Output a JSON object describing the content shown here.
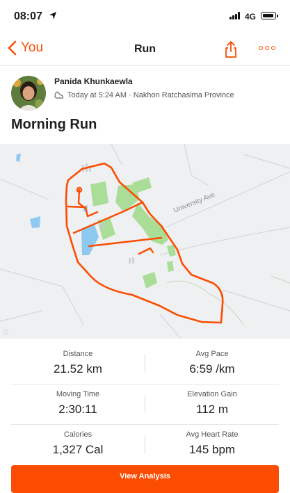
{
  "status_bar": {
    "time": "08:07",
    "network": "4G"
  },
  "nav": {
    "back_label": "You",
    "title": "Run"
  },
  "activity": {
    "athlete": "Panida Khunkaewla",
    "meta": "Today at 5:24 AM · Nakhon Ratchasima Province",
    "title": "Morning Run"
  },
  "map": {
    "road_label": "University Ave.",
    "route_color": "#fc4c02"
  },
  "stats": [
    {
      "left": {
        "label": "Distance",
        "value": "21.52 km"
      },
      "right": {
        "label": "Avg Pace",
        "value": "6:59 /km"
      }
    },
    {
      "left": {
        "label": "Moving Time",
        "value": "2:30:11"
      },
      "right": {
        "label": "Elevation Gain",
        "value": "112 m"
      }
    },
    {
      "left": {
        "label": "Calories",
        "value": "1,327 Cal"
      },
      "right": {
        "label": "Avg Heart Rate",
        "value": "145 bpm"
      }
    }
  ],
  "cta": {
    "label": "View Analysis"
  },
  "colors": {
    "accent": "#fc4c02",
    "park": "#a9dd98",
    "water": "#8ec9f2"
  }
}
